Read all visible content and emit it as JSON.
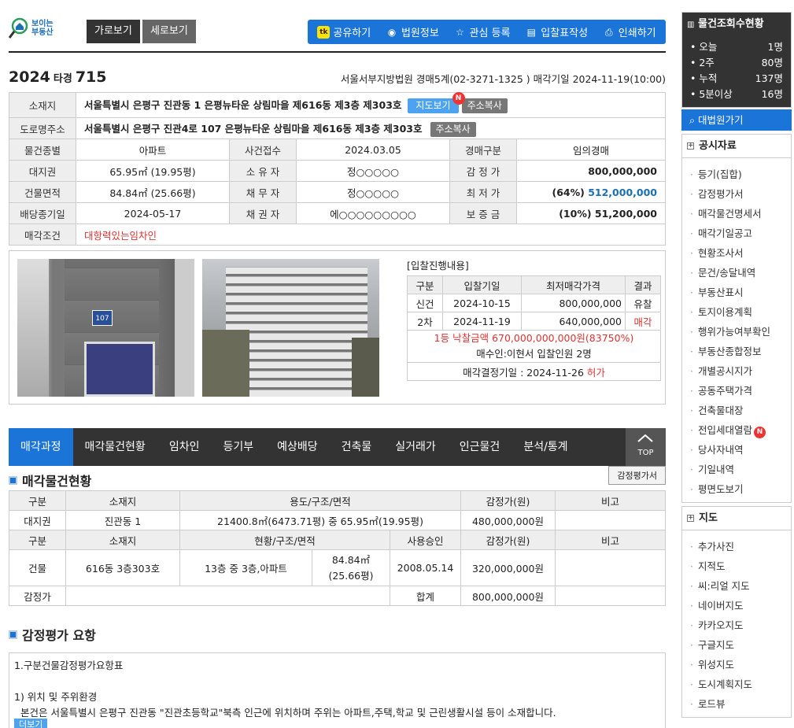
{
  "logo": {
    "line1": "보이는",
    "line2": "부동산"
  },
  "view": {
    "horizontal": "가로보기",
    "vertical": "세로보기"
  },
  "toolbar": [
    {
      "label": "공유하기",
      "icon": "kakao-icon"
    },
    {
      "label": "법원정보",
      "icon": "globe-icon"
    },
    {
      "label": "관심 등록",
      "icon": "star-icon"
    },
    {
      "label": "입찰표작성",
      "icon": "form-icon"
    },
    {
      "label": "인쇄하기",
      "icon": "print-icon"
    }
  ],
  "case": {
    "year": "2024",
    "type": "타경",
    "num": "715",
    "court": "서울서부지방법원 경매5계(02-3271-1325 ) 매각기일 2024-11-19(10:00)"
  },
  "info": {
    "addr_label": "소재지",
    "addr": "서울특별시 은평구 진관동 1 은평뉴타운 상림마을 제616동 제3층 제303호",
    "map_btn": "지도보기",
    "badge_n": "N",
    "copy_btn": "주소복사",
    "road_label": "도로명주소",
    "road": "서울특별시 은평구 진관4로 107 은평뉴타운 상림마을 제616동 제3층 제303호",
    "rows": [
      [
        "물건종별",
        "아파트",
        "사건접수",
        "2024.03.05",
        "경매구분",
        "임의경매"
      ],
      [
        "대지권",
        "65.95㎡ (19.95평)",
        "소 유 자",
        "정○○○○○",
        "감 정 가",
        "800,000,000"
      ],
      [
        "건물면적",
        "84.84㎡ (25.66평)",
        "채 무 자",
        "정○○○○○",
        "최 저 가",
        ""
      ],
      [
        "배당종기일",
        "2024-05-17",
        "채 권 자",
        "에○○○○○○○○○",
        "보 증 금",
        "(10%) 51,200,000"
      ]
    ],
    "min_pct": "(64%)",
    "min_price": "512,000,000",
    "cond_label": "매각조건",
    "cond": "대항력있는임차인"
  },
  "bid": {
    "title": "[입찰진행내용]",
    "headers": [
      "구분",
      "입찰기일",
      "최저매각가격",
      "결과"
    ],
    "rows": [
      [
        "신건",
        "2024-10-15",
        "800,000,000",
        "유찰"
      ],
      [
        "2차",
        "2024-11-19",
        "640,000,000",
        "매각"
      ]
    ],
    "winner": "1등 낙찰금액 670,000,000,000원(83750%)",
    "buyer": "매수인:이현서 입찰인원 2명",
    "decision": "매각결정기일 : 2024-11-26",
    "decision_status": "허가"
  },
  "photo": {
    "plate": "107"
  },
  "tabs": [
    "매각과정",
    "매각물건현황",
    "임차인",
    "등기부",
    "예상배당",
    "건축물",
    "실거래가",
    "인근물건",
    "분석/통계"
  ],
  "top_label": "TOP",
  "objsec": {
    "title": "매각물건현황",
    "btn": "감정평가서"
  },
  "land": {
    "headers": [
      "구분",
      "소재지",
      "용도/구조/면적",
      "감정가(원)",
      "비고"
    ],
    "row": [
      "대지권",
      "진관동 1",
      "21400.8㎡(6473.71평) 중 65.95㎡(19.95평)",
      "480,000,000원",
      ""
    ]
  },
  "bldg": {
    "headers": [
      "구분",
      "소재지",
      "현황/구조/면적",
      "사용승인",
      "감정가(원)",
      "비고"
    ],
    "row": [
      "건물",
      "616동 3층303호",
      "13층 중 3층,아파트",
      "84.84㎡",
      "(25.66평)",
      "2008.05.14",
      "320,000,000원",
      ""
    ],
    "total_label": "감정가",
    "sum_label": "합계",
    "sum": "800,000,000원"
  },
  "summary": {
    "title": "감정평가 요항",
    "line1": "1.구분건물감정평가요항표",
    "line2": "1) 위치 및 주위환경",
    "line3": "본건은 서울특별시 은평구 진관동 \"진관초등학교\"북측 인근에 위치하며 주위는 아파트,주택,학교 및 근린생활시설 등이 소재합니다.",
    "more": "더보기"
  },
  "side": {
    "views_title": "물건조회수현황",
    "views": [
      [
        "• 오늘",
        "1명"
      ],
      [
        "• 2주",
        "80명"
      ],
      [
        "• 누적",
        "137명"
      ],
      [
        "• 5분이상",
        "16명"
      ]
    ],
    "court_btn": "대법원가기",
    "docs_title": "공시자료",
    "docs": [
      "등기(집합)",
      "감정평가서",
      "매각물건명세서",
      "매각기일공고",
      "현황조사서",
      "문건/송달내역",
      "부동산표시",
      "토지이용계획",
      "행위가능여부확인",
      "부동산종합정보",
      "개별공시지가",
      "공동주택가격",
      "건축물대장",
      "전입세대열람",
      "당사자내역",
      "기일내역",
      "평면도보기"
    ],
    "map_title": "지도",
    "maps": [
      "추가사진",
      "지적도",
      "씨:리얼 지도",
      "네이버지도",
      "카카오지도",
      "구글지도",
      "위성지도",
      "도시계획지도",
      "로드뷰"
    ]
  }
}
